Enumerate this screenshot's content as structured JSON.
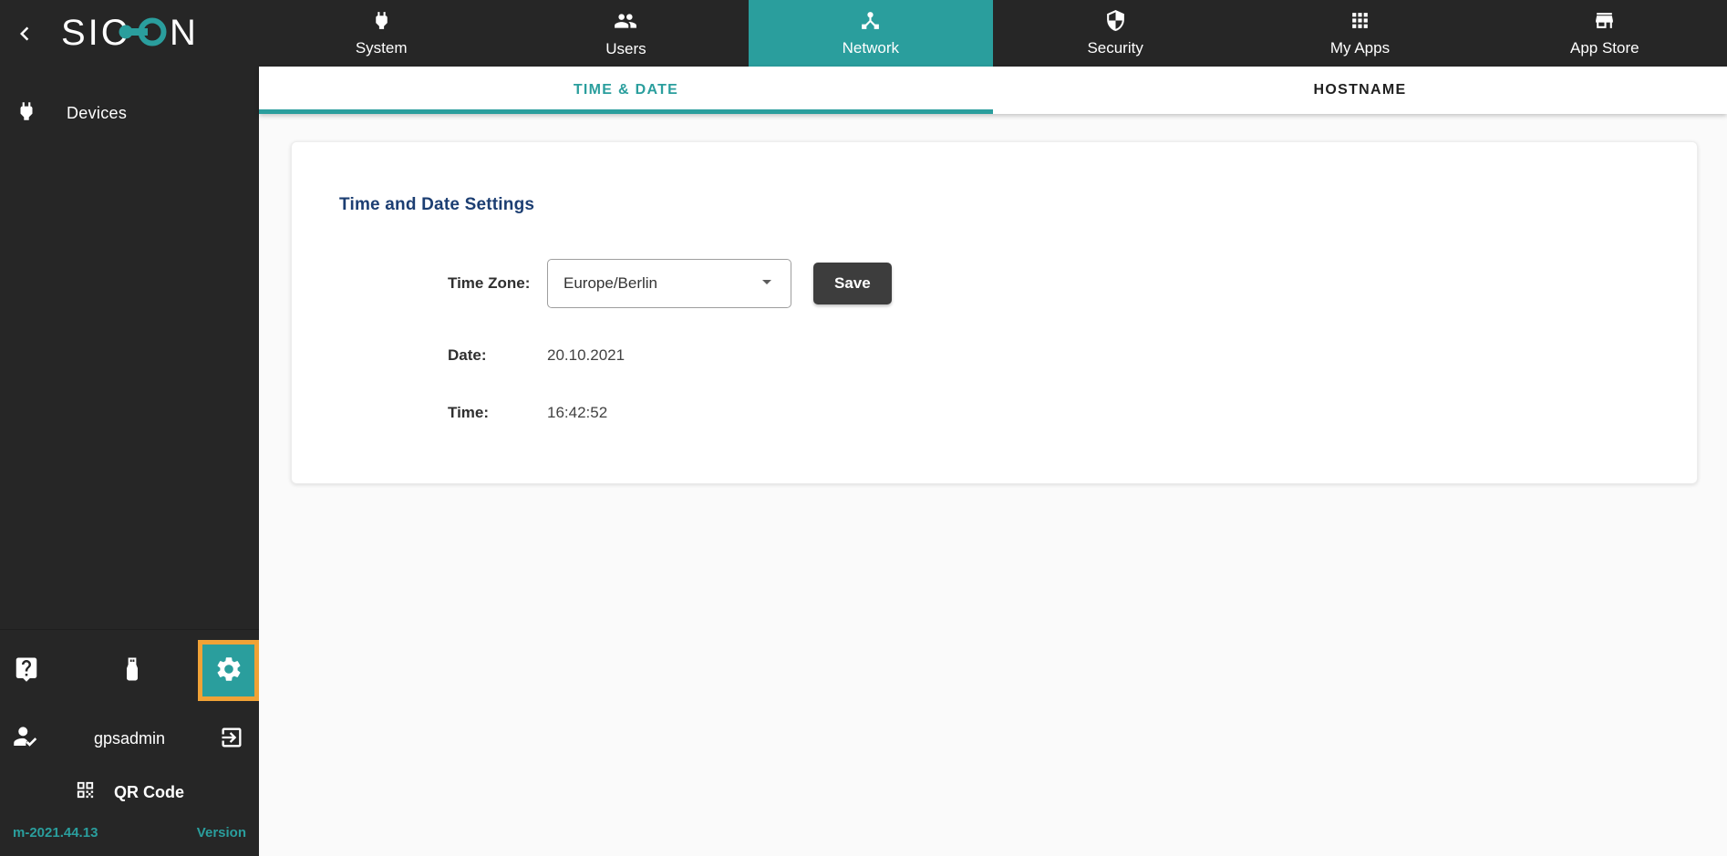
{
  "sidebar": {
    "logo_text": "SICON",
    "devices_label": "Devices",
    "username": "gpsadmin",
    "qr_label": "QR Code",
    "version_value": "m-2021.44.13",
    "version_label": "Version"
  },
  "header": {
    "tabs": [
      {
        "label": "System",
        "icon": "plug-icon",
        "active": false
      },
      {
        "label": "Users",
        "icon": "users-icon",
        "active": false
      },
      {
        "label": "Network",
        "icon": "network-icon",
        "active": true
      },
      {
        "label": "Security",
        "icon": "shield-icon",
        "active": false
      },
      {
        "label": "My Apps",
        "icon": "grid-icon",
        "active": false
      },
      {
        "label": "App Store",
        "icon": "store-icon",
        "active": false
      }
    ]
  },
  "subtabs": [
    {
      "label": "TIME & DATE",
      "active": true
    },
    {
      "label": "HOSTNAME",
      "active": false
    }
  ],
  "content": {
    "card_title": "Time and Date Settings",
    "timezone_label": "Time Zone:",
    "timezone_value": "Europe/Berlin",
    "save_label": "Save",
    "date_label": "Date:",
    "date_value": "20.10.2021",
    "time_label": "Time:",
    "time_value": "16:42:52"
  },
  "colors": {
    "accent_teal": "#2a9e9d",
    "highlight_orange": "#f0a236",
    "heading_navy": "#1c3e72",
    "dark_bg": "#262626"
  }
}
